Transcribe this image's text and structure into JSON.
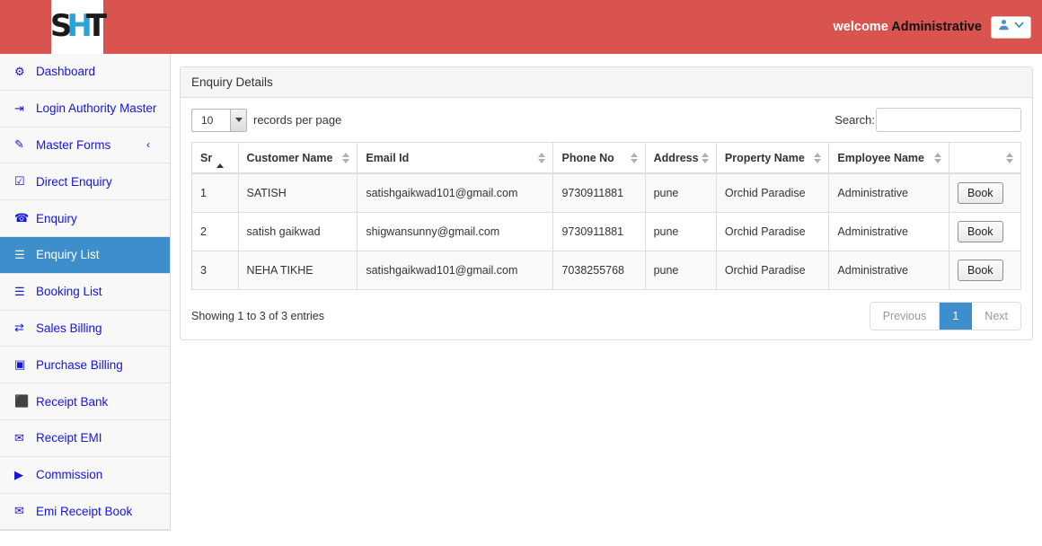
{
  "header": {
    "logo": {
      "part1": "S",
      "part2": "H",
      "part3": "T",
      "icon": "sht-logo-icon"
    },
    "welcome_label": "welcome ",
    "user_name": "Administrative",
    "user_icon": "user-icon",
    "chevron_icon": "chevron-down-icon",
    "bg_color": "#d9534f"
  },
  "sidebar": {
    "active_color": "#3d8ecb",
    "link_color": "#1414e0",
    "items": [
      {
        "label": "Dashboard",
        "icon": "dashboard-icon",
        "glyph": "⚙",
        "active": false,
        "caret": ""
      },
      {
        "label": "Login Authority Master",
        "icon": "sign-out-icon",
        "glyph": "⇥",
        "active": false,
        "caret": ""
      },
      {
        "label": "Master Forms",
        "icon": "pencil-icon",
        "glyph": "✎",
        "active": false,
        "caret": "‹"
      },
      {
        "label": "Direct Enquiry",
        "icon": "check-square-icon",
        "glyph": "☑",
        "active": false,
        "caret": ""
      },
      {
        "label": "Enquiry",
        "icon": "phone-icon",
        "glyph": "☎",
        "active": false,
        "caret": ""
      },
      {
        "label": "Enquiry List",
        "icon": "list-icon",
        "glyph": "☰",
        "active": true,
        "caret": ""
      },
      {
        "label": "Booking List",
        "icon": "list-icon",
        "glyph": "☰",
        "active": false,
        "caret": ""
      },
      {
        "label": "Sales Billing",
        "icon": "exchange-icon",
        "glyph": "⇄",
        "active": false,
        "caret": ""
      },
      {
        "label": "Purchase Billing",
        "icon": "money-icon",
        "glyph": "▣",
        "active": false,
        "caret": ""
      },
      {
        "label": "Receipt Bank",
        "icon": "file-icon",
        "glyph": "⬛",
        "active": false,
        "caret": ""
      },
      {
        "label": "Receipt EMI",
        "icon": "envelope-icon",
        "glyph": "✉",
        "active": false,
        "caret": ""
      },
      {
        "label": "Commission",
        "icon": "play-box-icon",
        "glyph": "▶",
        "active": false,
        "caret": ""
      },
      {
        "label": "Emi Receipt Book",
        "icon": "envelope-icon",
        "glyph": "✉",
        "active": false,
        "caret": ""
      }
    ]
  },
  "panel": {
    "title": "Enquiry Details",
    "length_menu": {
      "selected": "10",
      "suffix_label": "records per page"
    },
    "search": {
      "label": "Search:",
      "value": "",
      "placeholder": ""
    },
    "table": {
      "columns": [
        {
          "label": "Sr",
          "sort": "asc"
        },
        {
          "label": "Customer Name",
          "sort": "both"
        },
        {
          "label": "Email Id",
          "sort": "both"
        },
        {
          "label": "Phone No",
          "sort": "both"
        },
        {
          "label": "Address",
          "sort": "both"
        },
        {
          "label": "Property Name",
          "sort": "both"
        },
        {
          "label": "Employee Name",
          "sort": "both"
        },
        {
          "label": "",
          "sort": "both"
        }
      ],
      "rows": [
        {
          "sr": "1",
          "customer_name": "SATISH",
          "email": "satishgaikwad101@gmail.com",
          "phone": "9730911881",
          "address": "pune",
          "property_name": "Orchid Paradise",
          "employee_name": "Administrative",
          "action_label": "Book"
        },
        {
          "sr": "2",
          "customer_name": "satish gaikwad",
          "email": "shigwansunny@gmail.com",
          "phone": "9730911881",
          "address": "pune",
          "property_name": "Orchid Paradise",
          "employee_name": "Administrative",
          "action_label": "Book"
        },
        {
          "sr": "3",
          "customer_name": "NEHA TIKHE",
          "email": "satishgaikwad101@gmail.com",
          "phone": "7038255768",
          "address": "pune",
          "property_name": "Orchid Paradise",
          "employee_name": "Administrative",
          "action_label": "Book"
        }
      ]
    },
    "footer": {
      "info": "Showing 1 to 3 of 3 entries",
      "pagination": [
        {
          "label": "Previous",
          "current": false
        },
        {
          "label": "1",
          "current": true
        },
        {
          "label": "Next",
          "current": false
        }
      ]
    }
  }
}
